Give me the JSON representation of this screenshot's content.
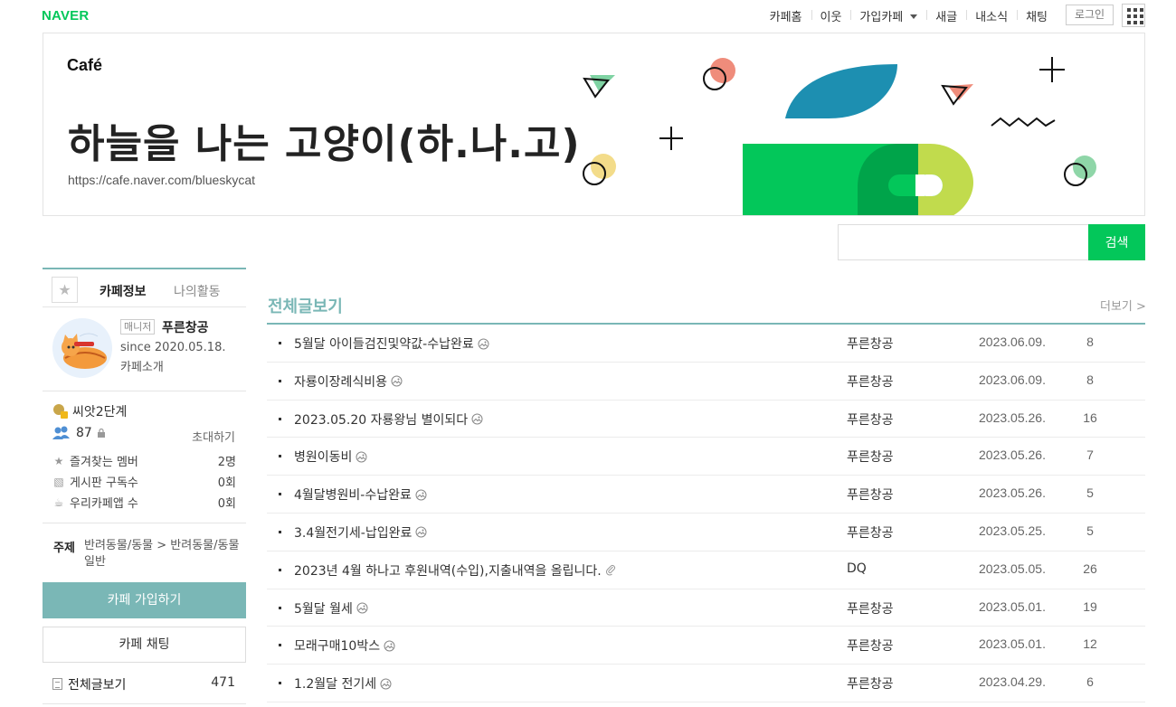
{
  "gnb": {
    "logo": "NAVER",
    "menu": [
      "카페홈",
      "이웃",
      "가입카페",
      "새글",
      "내소식",
      "채팅"
    ],
    "login": "로그인"
  },
  "banner": {
    "cafe_logo": "Café",
    "title": "하늘을 나는 고양이(하.나.고)",
    "url": "https://cafe.naver.com/blueskycat"
  },
  "search": {
    "placeholder": "",
    "button": "검색"
  },
  "sidebar": {
    "tab_info": "카페정보",
    "tab_activity": "나의활동",
    "manager_badge": "매니저",
    "manager_name": "푸른창공",
    "since": "since 2020.05.18.",
    "intro": "카페소개",
    "level": "씨앗2단계",
    "member_count": "87",
    "invite": "초대하기",
    "stats": [
      {
        "label": "즐겨찾는 멤버",
        "value": "2명"
      },
      {
        "label": "게시판 구독수",
        "value": "0회"
      },
      {
        "label": "우리카페앱 수",
        "value": "0회"
      }
    ],
    "topic_label": "주제",
    "topic_value": "반려동물/동물 > 반려동물/동물일반",
    "join_button": "카페 가입하기",
    "chat_button": "카페 채팅",
    "all_posts_label": "전체글보기",
    "all_posts_count": "471"
  },
  "board": {
    "title": "전체글보기",
    "more": "더보기 >",
    "posts": [
      {
        "title": "5월달 아이들검진및약값-수납완료",
        "attach": "image",
        "author": "푸른창공",
        "date": "2023.06.09.",
        "views": "8"
      },
      {
        "title": "자룡이장례식비용",
        "attach": "image",
        "author": "푸른창공",
        "date": "2023.06.09.",
        "views": "8"
      },
      {
        "title": "2023.05.20 자룡왕님 별이되다",
        "attach": "image",
        "author": "푸른창공",
        "date": "2023.05.26.",
        "views": "16"
      },
      {
        "title": "병원이동비",
        "attach": "image",
        "author": "푸른창공",
        "date": "2023.05.26.",
        "views": "7"
      },
      {
        "title": "4월달병원비-수납완료",
        "attach": "image",
        "author": "푸른창공",
        "date": "2023.05.26.",
        "views": "5"
      },
      {
        "title": "3.4월전기세-납입완료",
        "attach": "image",
        "author": "푸른창공",
        "date": "2023.05.25.",
        "views": "5"
      },
      {
        "title": "2023년 4월 하나고 후원내역(수입),지출내역을 올립니다.",
        "attach": "file",
        "author": "DQ",
        "date": "2023.05.05.",
        "views": "26"
      },
      {
        "title": "5월달 월세",
        "attach": "image",
        "author": "푸른창공",
        "date": "2023.05.01.",
        "views": "19"
      },
      {
        "title": "모래구매10박스",
        "attach": "image",
        "author": "푸른창공",
        "date": "2023.05.01.",
        "views": "12"
      },
      {
        "title": "1.2월달 전기세",
        "attach": "image",
        "author": "푸른창공",
        "date": "2023.04.29.",
        "views": "6"
      }
    ]
  },
  "colors": {
    "naver_green": "#03c75a",
    "accent_teal": "#7ab7b6"
  }
}
